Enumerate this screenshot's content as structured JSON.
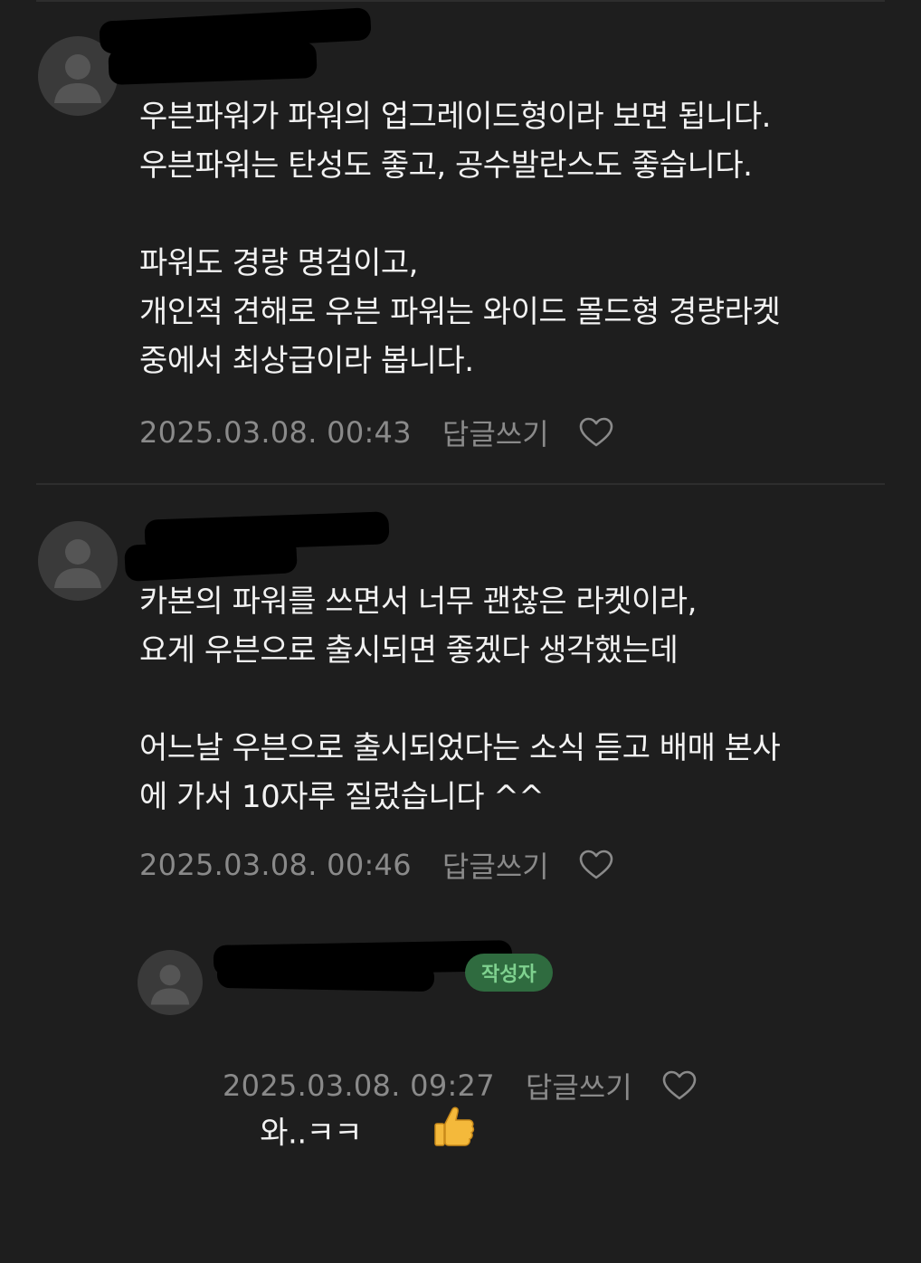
{
  "comments": [
    {
      "body": "우븐파워가 파워의 업그레이드형이라 보면 됩니다.\n우븐파워는 탄성도 좋고, 공수발란스도 좋습니다.\n\n파워도 경량 명검이고,\n개인적 견해로 우븐 파워는 와이드 몰드형 경량라켓\n중에서 최상급이라 봅니다.",
      "date": "2025.03.08. 00:43",
      "reply_label": "답글쓰기"
    },
    {
      "body": "카본의 파워를 쓰면서 너무 괜찮은 라켓이라,\n요게 우븐으로 출시되면 좋겠다 생각했는데\n\n어느날 우븐으로 출시되었다는 소식 듣고 배매 본사\n에 가서 10자루 질렀습니다 ^^",
      "date": "2025.03.08. 00:46",
      "reply_label": "답글쓰기"
    }
  ],
  "reply": {
    "badge": "작성자",
    "body": "와..ㅋㅋ",
    "emoji": "thumbs-up-icon",
    "date": "2025.03.08. 09:27",
    "reply_label": "답글쓰기"
  },
  "colors": {
    "background": "#1e1e1e",
    "text": "#f2f2f2",
    "meta": "#8a8a8a",
    "badge_bg": "#2f6b3f",
    "badge_text": "#7fd18f"
  }
}
